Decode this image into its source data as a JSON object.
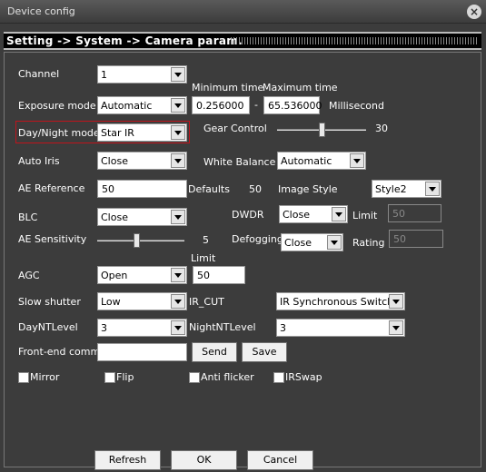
{
  "window": {
    "title": "Device config",
    "close_icon": "close-icon"
  },
  "header": {
    "breadcrumb": "Setting -> System -> Camera param."
  },
  "form": {
    "channel": {
      "label": "Channel",
      "value": "1"
    },
    "exposure": {
      "label": "Exposure mode",
      "value": "Automatic",
      "min_label": "Minimum time",
      "max_label": "Maximum time",
      "min_value": "0.256000",
      "dash": "-",
      "max_value": "65.536000",
      "unit": "Millisecond"
    },
    "day_night": {
      "label": "Day/Night mode",
      "value": "Star IR"
    },
    "gear_control": {
      "label": "Gear Control",
      "value": "30",
      "level": 0.5
    },
    "auto_iris": {
      "label": "Auto Iris",
      "value": "Close"
    },
    "white_balance": {
      "label": "White Balance",
      "value": "Automatic"
    },
    "ae_reference": {
      "label": "AE Reference",
      "value": "50",
      "defaults_label": "Defaults",
      "defaults_value": "50"
    },
    "image_style": {
      "label": "Image Style",
      "value": "Style2"
    },
    "blc": {
      "label": "BLC",
      "value": "Close"
    },
    "dwdr": {
      "label": "DWDR",
      "value": "Close",
      "limit_label": "Limit",
      "limit_value": "50"
    },
    "ae_sensitivity": {
      "label": "AE Sensitivity",
      "value": "5",
      "level": 0.45
    },
    "defogging": {
      "label": "Defogging",
      "value": "Close",
      "rating_label": "Rating",
      "rating_value": "50"
    },
    "agc": {
      "label": "AGC",
      "value": "Open",
      "limit_label": "Limit",
      "limit_value": "50"
    },
    "slow_shutter": {
      "label": "Slow shutter",
      "value": "Low"
    },
    "ir_cut": {
      "label": "IR_CUT",
      "value": "IR Synchronous Switch"
    },
    "day_nt_level": {
      "label": "DayNTLevel",
      "value": "3"
    },
    "night_nt_level": {
      "label": "NightNTLevel",
      "value": "3"
    },
    "front_end_comm": {
      "label": "Front-end comm",
      "value": "",
      "send_label": "Send",
      "save_label": "Save"
    },
    "checkboxes": {
      "mirror": "Mirror",
      "flip": "Flip",
      "anti_flicker": "Anti flicker",
      "irswap": "IRSwap"
    }
  },
  "footer": {
    "refresh_label": "Refresh",
    "ok_label": "OK",
    "cancel_label": "Cancel"
  },
  "colors": {
    "window_bg": "#3c3c3c",
    "highlight_border": "#c0141c",
    "header_bg": "#000000"
  }
}
